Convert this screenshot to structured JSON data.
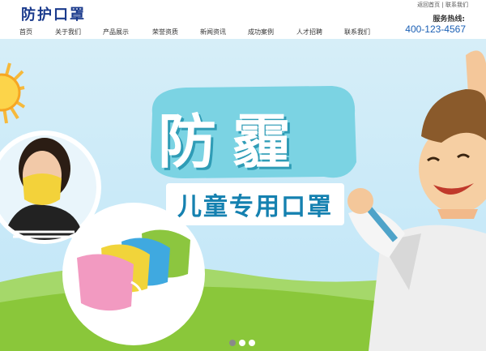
{
  "header": {
    "logo_text": "防护口罩",
    "top_links": [
      "返回首页",
      "联系我们"
    ],
    "top_links_sep": "|",
    "hotline_label": "服务热线:",
    "hotline_number": "400-123-4567"
  },
  "nav": [
    "首页",
    "关于我们",
    "产品展示",
    "荣誉资质",
    "新闻资讯",
    "成功案例",
    "人才招聘",
    "联系我们"
  ],
  "banner": {
    "headline": "防霾",
    "subtitle": "儿童专用口罩",
    "slide_count": 3,
    "active_slide": 1
  },
  "colors": {
    "logo": "#1a3a8c",
    "hotline": "#1a5fb4",
    "headline_shadow": "#2f9cb6",
    "subtitle_text": "#1581b0",
    "grass": "#8ac73a"
  }
}
